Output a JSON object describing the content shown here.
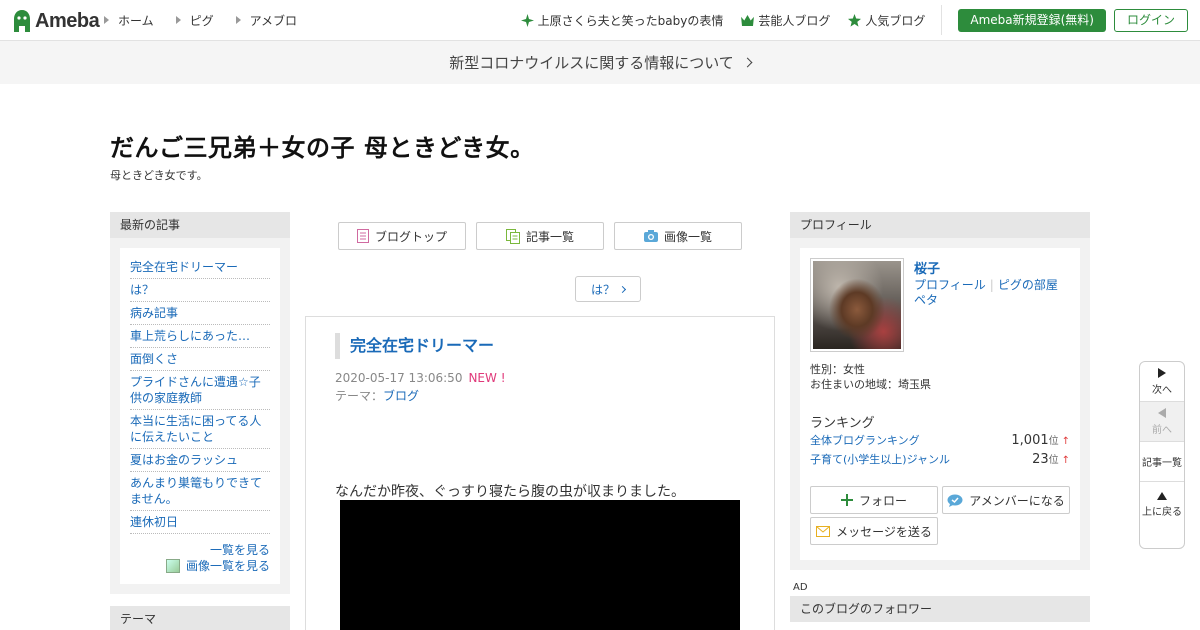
{
  "header": {
    "logo_text": "Ameba",
    "nav": [
      {
        "label": "ホーム"
      },
      {
        "label": "ピグ"
      },
      {
        "label": "アメブロ"
      }
    ],
    "right_links": [
      {
        "label": "上原さくら夫と笑ったbabyの表情",
        "icon": "sparkle-icon"
      },
      {
        "label": "芸能人ブログ",
        "icon": "crown-icon"
      },
      {
        "label": "人気ブログ",
        "icon": "star-icon"
      }
    ],
    "register_label": "Ameba新規登録(無料)",
    "login_label": "ログイン",
    "brand_color": "#2d8c3c"
  },
  "banner": {
    "text": "新型コロナウイルスに関する情報について"
  },
  "blog": {
    "title": "だんご三兄弟＋女の子 母ときどき女。",
    "description": "母ときどき女です。"
  },
  "left_sidebar": {
    "recent_heading": "最新の記事",
    "recent_items": [
      "完全在宅ドリーマー",
      "は？",
      "病み記事",
      "車上荒らしにあった…",
      "面倒くさ",
      "プライドさんに遭遇☆子供の家庭教師",
      "本当に生活に困ってる人に伝えたいこと",
      "夏はお金のラッシュ",
      "あんまり巣篭もりできてません。",
      "連休初日"
    ],
    "see_all": "一覧を見る",
    "see_images": "画像一覧を見る",
    "theme_heading": "テーマ"
  },
  "center": {
    "buttons": [
      "ブログトップ",
      "記事一覧",
      "画像一覧"
    ],
    "prev_article": "は？",
    "article": {
      "title": "完全在宅ドリーマー",
      "datetime": "2020-05-17 13:06:50",
      "new_badge": "NEW !",
      "theme_label": "テーマ：",
      "theme_value": "ブログ",
      "body_text": "なんだか昨夜、ぐっすり寝たら腹の虫が収まりました。"
    }
  },
  "right_sidebar": {
    "profile_heading": "プロフィール",
    "name": "桜子",
    "link_profile": "プロフィール",
    "link_pig": "ピグの部屋",
    "link_peta": "ペタ",
    "gender": "性別：女性",
    "region": "お住まいの地域：埼玉県",
    "ranking_heading": "ランキング",
    "rankings": [
      {
        "label": "全体ブログランキング",
        "value": "1,001",
        "unit": "位",
        "trend": "↑"
      },
      {
        "label": "子育て(小学生以上)ジャンル",
        "value": "23",
        "unit": "位",
        "trend": "↑"
      }
    ],
    "follow_label": "フォロー",
    "amember_label": "アメンバーになる",
    "message_label": "メッセージを送る",
    "ad_label": "AD",
    "followers_heading": "このブログのフォロワー"
  },
  "float_nav": {
    "next": "次へ",
    "prev": "前へ",
    "list": "記事一覧",
    "top": "上に戻る"
  }
}
